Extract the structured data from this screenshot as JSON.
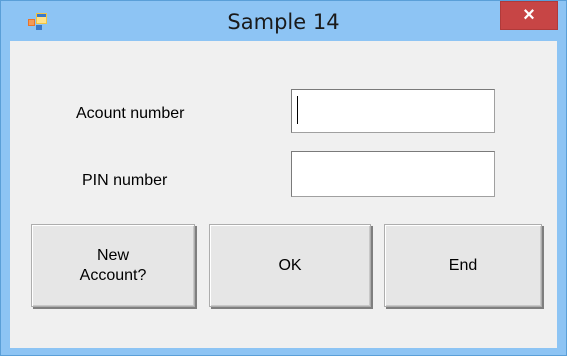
{
  "window": {
    "title": "Sample 14",
    "close_glyph": "×",
    "app_icon": "windows-forms-app-icon",
    "colors": {
      "frame": "#8dc4f4",
      "close": "#c74545",
      "client": "#f0f0f0"
    }
  },
  "form": {
    "account_label": "Acount number",
    "account_value": "",
    "pin_label": "PIN number",
    "pin_value": ""
  },
  "buttons": {
    "new_account": "New\nAccount?",
    "ok": "OK",
    "end": "End"
  }
}
